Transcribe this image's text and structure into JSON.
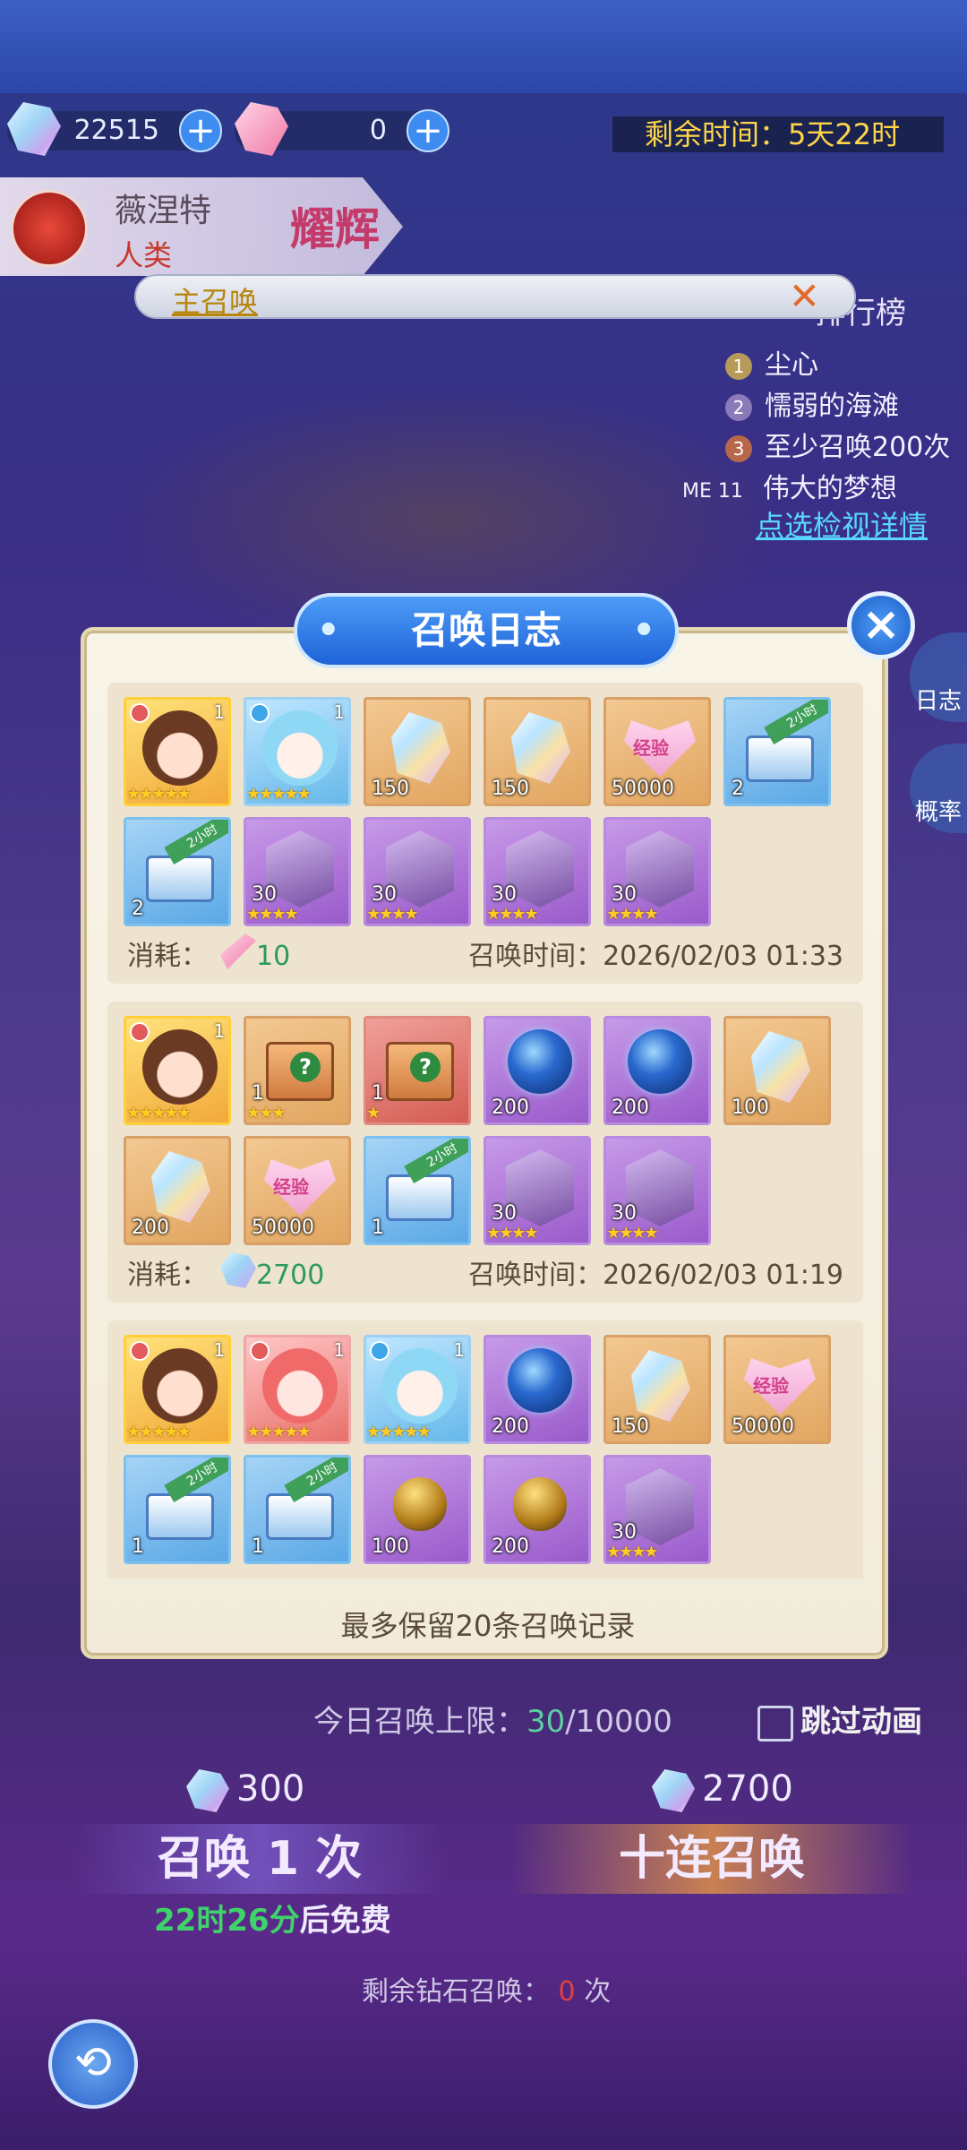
{
  "resources": {
    "gems": "22515",
    "tickets": "0"
  },
  "timer": {
    "label": "剩余时间：",
    "value": "5天22时"
  },
  "hero": {
    "name": "薇涅特",
    "race": "人类",
    "rank": "耀辉"
  },
  "pool_dropdown": {
    "label": "主召唤"
  },
  "ranking": {
    "title": "排行榜",
    "entries": [
      {
        "num": "1",
        "name": "尘心"
      },
      {
        "num": "2",
        "name": "懦弱的海滩"
      },
      {
        "num": "3",
        "name": "至少召唤200次"
      },
      {
        "num": "ME 11",
        "name": "伟大的梦想"
      }
    ],
    "link": "点选检视详情"
  },
  "side_buttons": {
    "log": "日志",
    "rate": "概率"
  },
  "modal": {
    "title": "召唤日志",
    "cost_label": "消耗：",
    "time_label": "召唤时间：",
    "footer": "最多保留20条召唤记录",
    "ribbon_text": "2小时",
    "heart_text": "经验",
    "mystery_glyph": "?",
    "records": [
      {
        "cost_icon": "ticket-icon",
        "cost": "10",
        "time": "2026/02/03 01:33",
        "items": [
          {
            "kind": "hero",
            "color": "hero-gold",
            "face": "brown",
            "element": "fire",
            "level": "1",
            "stars": "★★★★★"
          },
          {
            "kind": "hero",
            "color": "hero-blue",
            "face": "cyan",
            "element": "water",
            "level": "1",
            "stars": "★★★★★"
          },
          {
            "kind": "crystal",
            "color": "orange",
            "qty": "150"
          },
          {
            "kind": "crystal",
            "color": "orange",
            "qty": "150"
          },
          {
            "kind": "heart",
            "color": "orange",
            "qty": "50000"
          },
          {
            "kind": "chest",
            "color": "blue",
            "qty": "2",
            "ribbon": true
          },
          {
            "kind": "chest",
            "color": "blue",
            "qty": "2",
            "ribbon": true
          },
          {
            "kind": "shard",
            "color": "purple",
            "qty": "30",
            "stars": "★★★★"
          },
          {
            "kind": "shard",
            "color": "purple",
            "qty": "30",
            "stars": "★★★★"
          },
          {
            "kind": "shard",
            "color": "purple",
            "qty": "30",
            "stars": "★★★★"
          },
          {
            "kind": "shard",
            "color": "purple",
            "qty": "30",
            "stars": "★★★★"
          }
        ]
      },
      {
        "cost_icon": "gem-icon",
        "cost": "2700",
        "time": "2026/02/03 01:19",
        "items": [
          {
            "kind": "hero",
            "color": "hero-gold",
            "face": "brown",
            "element": "fire",
            "level": "1",
            "stars": "★★★★★"
          },
          {
            "kind": "mystery",
            "color": "orange",
            "qty": "1",
            "stars": "★★★"
          },
          {
            "kind": "mystery",
            "color": "redbox",
            "qty": "1",
            "stars": "★"
          },
          {
            "kind": "orb",
            "color": "purple",
            "qty": "200"
          },
          {
            "kind": "orb",
            "color": "purple",
            "qty": "200"
          },
          {
            "kind": "crystal",
            "color": "orange",
            "qty": "100"
          },
          {
            "kind": "crystal",
            "color": "orange",
            "qty": "200"
          },
          {
            "kind": "heart",
            "color": "orange",
            "qty": "50000"
          },
          {
            "kind": "chest",
            "color": "blue",
            "qty": "1",
            "ribbon": true
          },
          {
            "kind": "shard",
            "color": "purple",
            "qty": "30",
            "stars": "★★★★"
          },
          {
            "kind": "shard",
            "color": "purple",
            "qty": "30",
            "stars": "★★★★"
          }
        ]
      },
      {
        "cost_icon": "",
        "cost": "",
        "time": "",
        "items": [
          {
            "kind": "hero",
            "color": "hero-gold",
            "face": "brown",
            "element": "fire",
            "level": "1",
            "stars": "★★★★★"
          },
          {
            "kind": "hero",
            "color": "hero-red",
            "face": "pink",
            "element": "fire",
            "level": "1",
            "stars": "★★★★★"
          },
          {
            "kind": "hero",
            "color": "hero-blue",
            "face": "cyan",
            "element": "water",
            "level": "1",
            "stars": "★★★★★"
          },
          {
            "kind": "orb",
            "color": "purple",
            "qty": "200"
          },
          {
            "kind": "crystal",
            "color": "orange",
            "qty": "150"
          },
          {
            "kind": "heart",
            "color": "orange",
            "qty": "50000"
          },
          {
            "kind": "chest",
            "color": "blue",
            "qty": "1",
            "ribbon": true
          },
          {
            "kind": "chest",
            "color": "blue",
            "qty": "1",
            "ribbon": true
          },
          {
            "kind": "egg",
            "color": "purple",
            "qty": "100"
          },
          {
            "kind": "egg",
            "color": "purple",
            "qty": "200"
          },
          {
            "kind": "shard",
            "color": "purple",
            "qty": "30",
            "stars": "★★★★"
          }
        ]
      }
    ]
  },
  "daily_limit": {
    "label": "今日召唤上限：",
    "current": "30",
    "max": "/10000"
  },
  "skip_anim": "跳过动画",
  "summon_one": {
    "price": "300",
    "label": "召唤 1 次"
  },
  "summon_ten": {
    "price": "2700",
    "label": "十连召唤"
  },
  "free_timer": {
    "time": "22时26分",
    "suffix": "后免费"
  },
  "remaining": {
    "label": "剩余钻石召唤：",
    "count": "0",
    "unit": "次"
  },
  "back_glyph": "⟲",
  "colors": {
    "accent": "#2e7be8",
    "gold": "#ffd54a",
    "panel": "#f5efe1"
  }
}
